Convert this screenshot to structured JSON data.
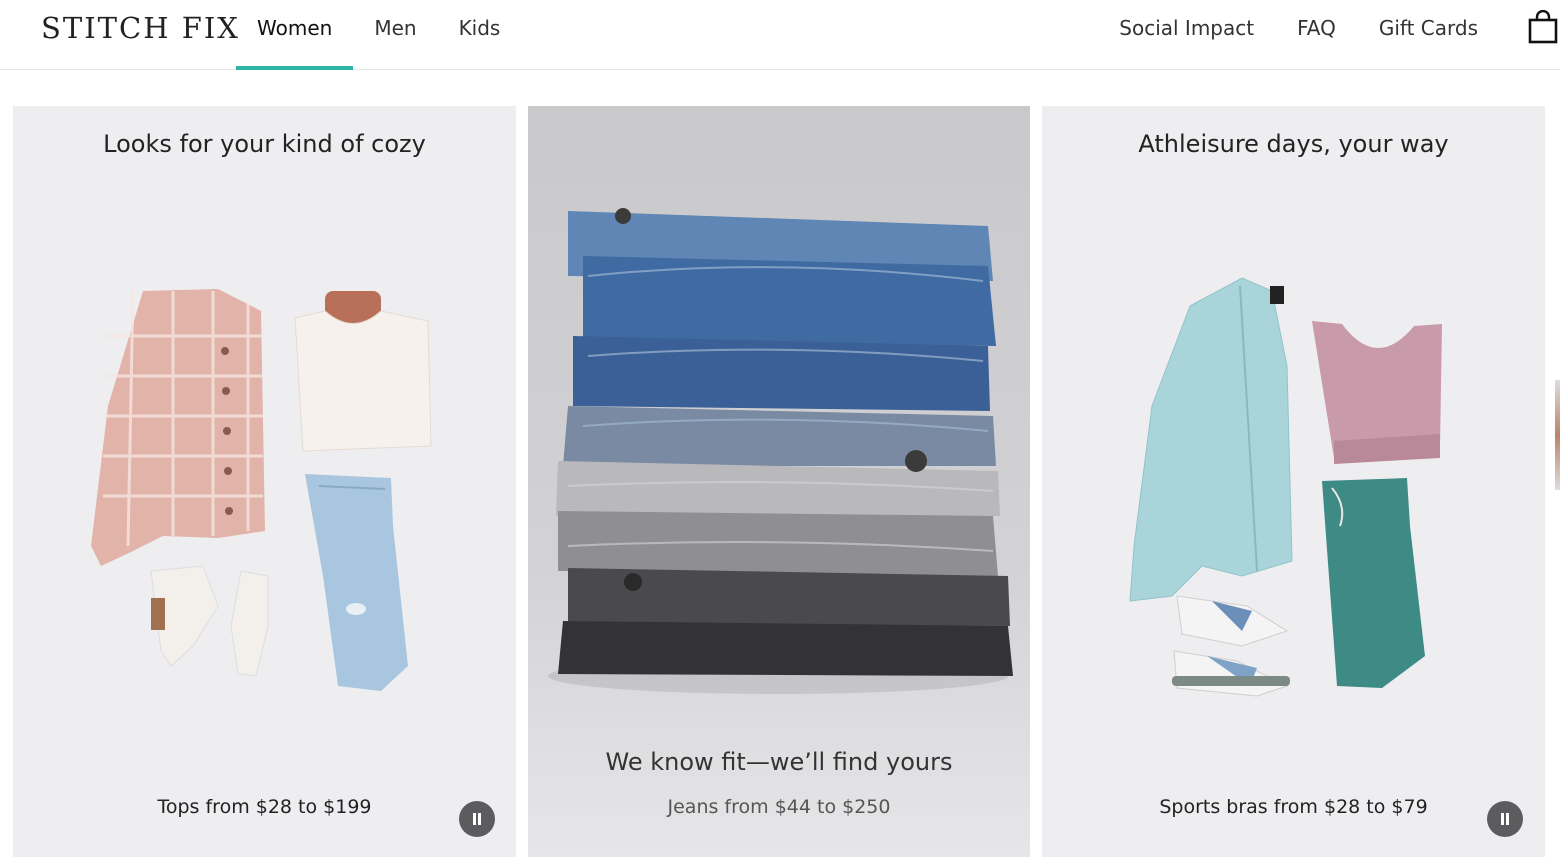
{
  "header": {
    "logo": "STITCH FIX",
    "nav_left": [
      "Women",
      "Men",
      "Kids"
    ],
    "active_nav": "Women",
    "nav_right": [
      "Social Impact",
      "FAQ",
      "Gift Cards"
    ],
    "bag_icon": "shopping-bag-icon"
  },
  "panels": [
    {
      "title": "Looks for your kind of cozy",
      "caption": "Tops from $28 to $199",
      "control_icon": "pause-icon"
    },
    {
      "title": "We know fit—we’ll find yours",
      "caption": "Jeans from $44 to $250"
    },
    {
      "title": "Athleisure days, your way",
      "caption": "Sports bras from $28 to $79",
      "control_icon": "pause-icon"
    }
  ],
  "colors": {
    "accent": "#2bb5a6",
    "panel_bg": "#eeeef1",
    "pause_bg": "#5c5c5f"
  }
}
